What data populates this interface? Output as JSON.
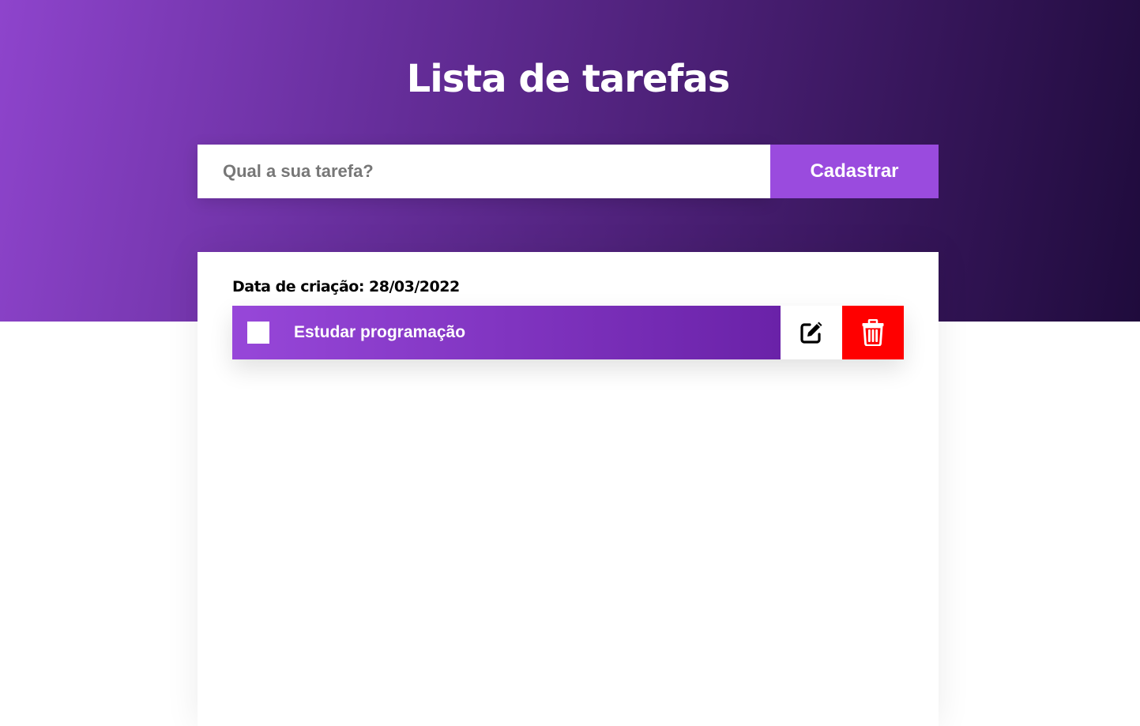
{
  "header": {
    "title": "Lista de tarefas",
    "gradient_colors": [
      "#8e44cc",
      "#1f0b3c"
    ]
  },
  "form": {
    "input_placeholder": "Qual a sua tarefa?",
    "input_value": "",
    "submit_label": "Cadastrar",
    "submit_color": "#9a4bde"
  },
  "tasks": {
    "created_label": "Data de criação: 28/03/2022",
    "items": [
      {
        "text": "Estudar programação",
        "checked": false,
        "edit_icon": "edit-icon",
        "delete_icon": "trash-icon",
        "delete_color": "#ff0000"
      }
    ]
  }
}
